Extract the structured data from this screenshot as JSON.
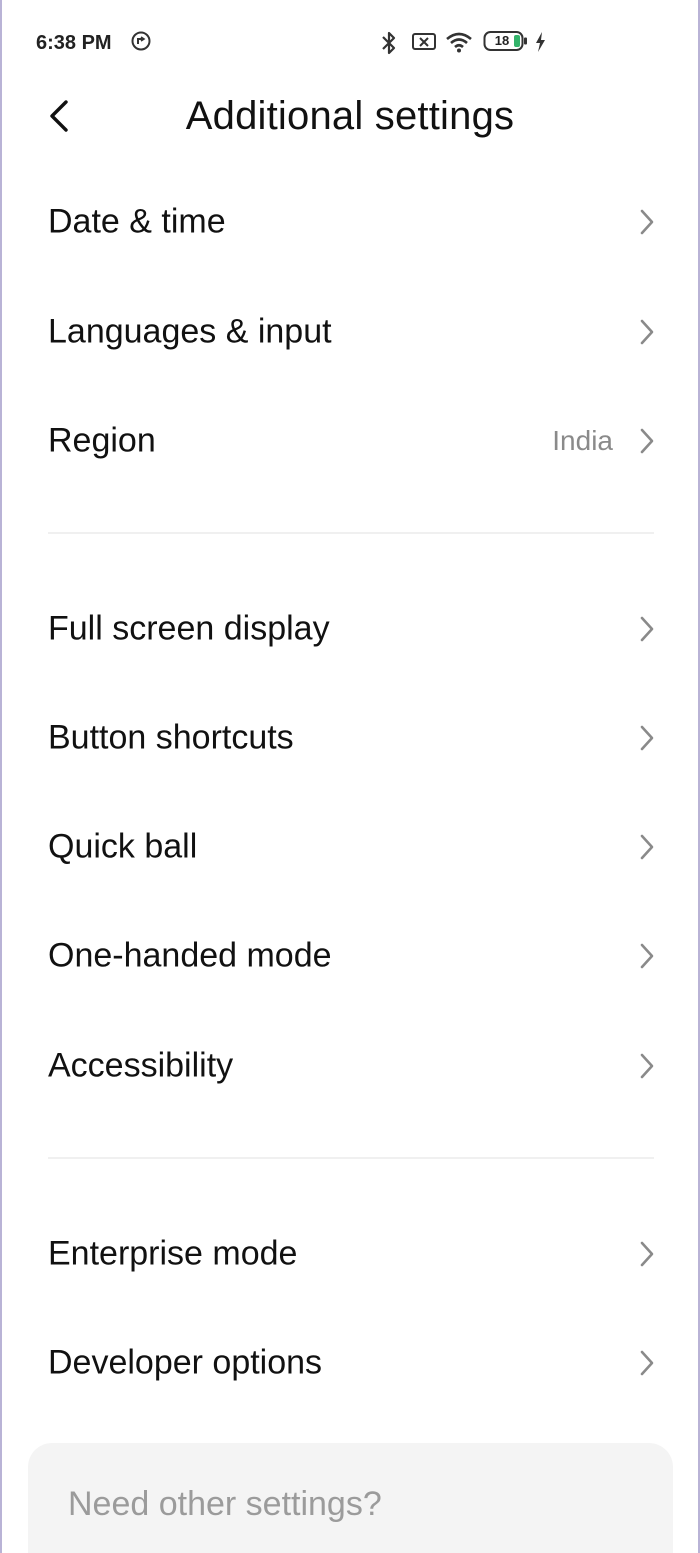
{
  "status_bar": {
    "time": "6:38 PM",
    "battery": "18",
    "icons": [
      "data-saver-icon",
      "bluetooth-icon",
      "sim-no-signal-icon",
      "wifi-icon",
      "battery-icon",
      "charging-icon"
    ]
  },
  "header": {
    "title": "Additional settings",
    "back_icon": "chevron-left-icon"
  },
  "sections": [
    {
      "items": [
        {
          "label": "Date & time",
          "value": ""
        },
        {
          "label": "Languages & input",
          "value": ""
        },
        {
          "label": "Region",
          "value": "India"
        }
      ]
    },
    {
      "items": [
        {
          "label": "Full screen display",
          "value": ""
        },
        {
          "label": "Button shortcuts",
          "value": ""
        },
        {
          "label": "Quick ball",
          "value": ""
        },
        {
          "label": "One-handed mode",
          "value": ""
        },
        {
          "label": "Accessibility",
          "value": ""
        }
      ]
    },
    {
      "items": [
        {
          "label": "Enterprise mode",
          "value": ""
        },
        {
          "label": "Developer options",
          "value": ""
        }
      ]
    }
  ],
  "other_settings": {
    "label": "Need other settings?"
  },
  "colors": {
    "background": "#ffffff",
    "text": "#111111",
    "secondary_text": "#8a8a8a",
    "chevron": "#8a8a8a",
    "card": "#f4f4f4",
    "frame": "#b9b3d6"
  }
}
